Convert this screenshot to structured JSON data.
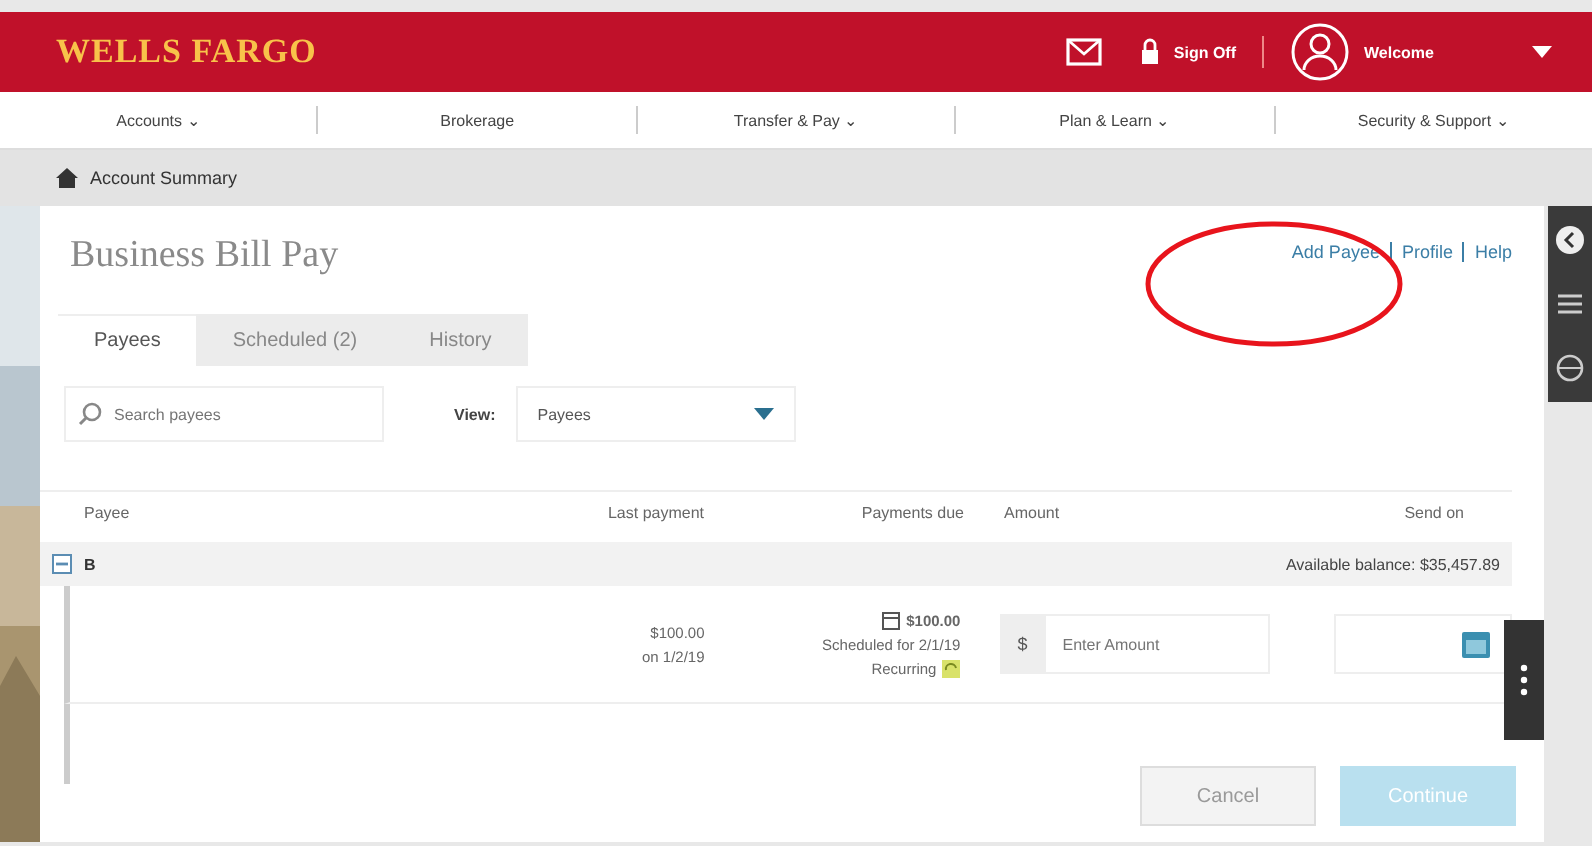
{
  "header": {
    "logo": "WELLS FARGO",
    "sign_off": "Sign Off",
    "welcome": "Welcome"
  },
  "nav": [
    "Accounts ⌄",
    "Brokerage",
    "Transfer & Pay ⌄",
    "Plan & Learn ⌄",
    "Security & Support ⌄"
  ],
  "breadcrumb": "Account Summary",
  "page_title": "Business Bill Pay",
  "links": [
    "Add Payee",
    "Profile",
    "Help"
  ],
  "tabs": [
    {
      "label": "Payees",
      "selected": true
    },
    {
      "label": "Scheduled (2)",
      "selected": false
    },
    {
      "label": "History",
      "selected": false
    }
  ],
  "search": {
    "placeholder": "Search payees"
  },
  "view": {
    "label": "View:",
    "value": "Payees"
  },
  "table": {
    "columns": [
      "Payee",
      "Last payment",
      "Payments due",
      "Amount",
      "Send on"
    ],
    "group": {
      "name": "B",
      "expanded": true,
      "balance": "Available balance: $35,457.89"
    },
    "rows": [
      {
        "last_amount": "$100.00",
        "last_date": "on 1/2/19",
        "due_amount": "$100.00",
        "due_note": "Scheduled for 2/1/19",
        "recurring": "Recurring",
        "currency": "$",
        "amount_placeholder": "Enter Amount"
      }
    ]
  },
  "buttons": [
    "Cancel",
    "Continue"
  ]
}
